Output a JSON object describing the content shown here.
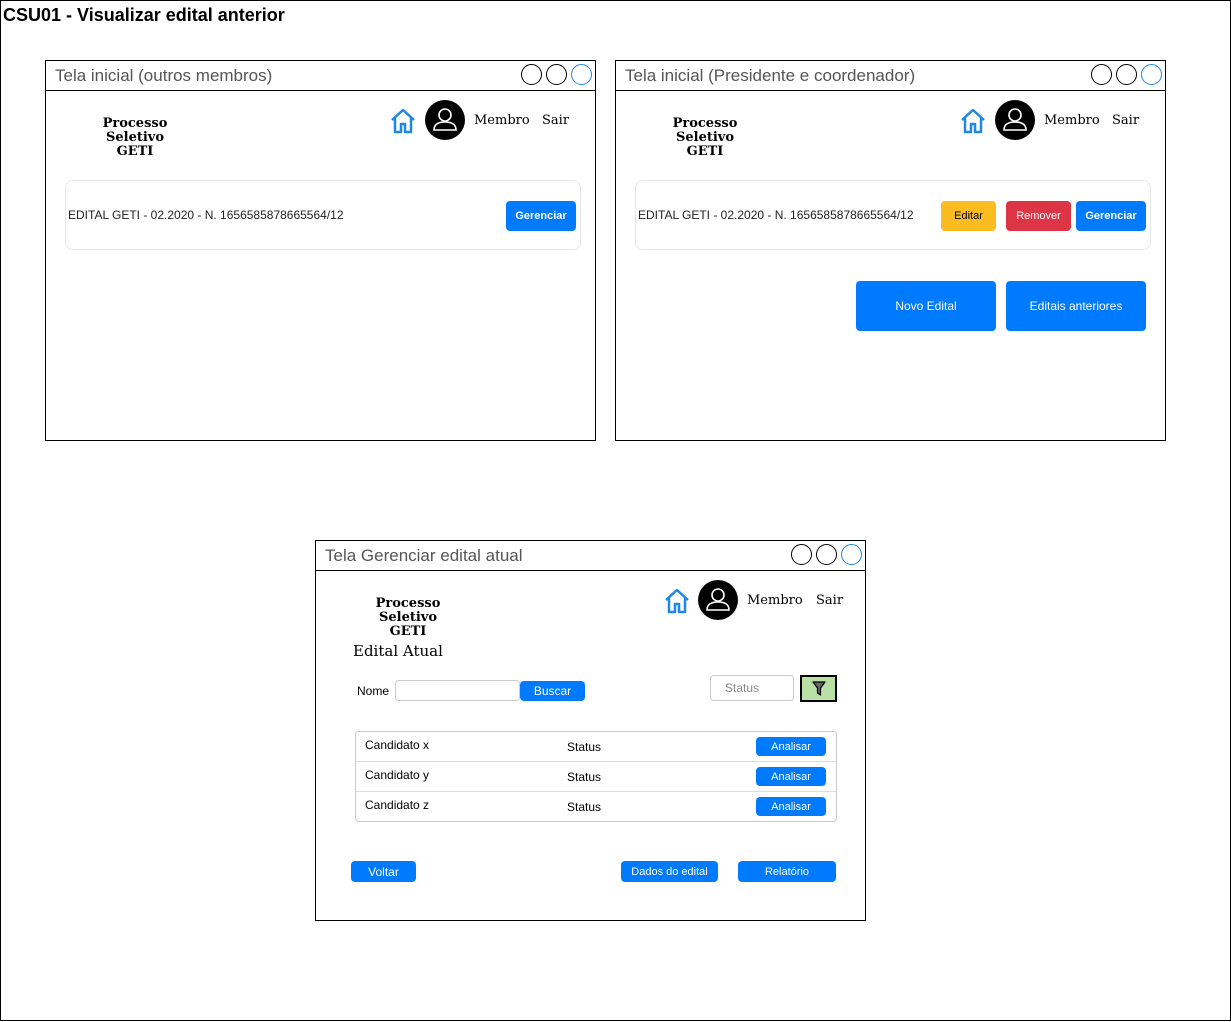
{
  "page_title": "CSU01 - Visualizar edital anterior",
  "brand": {
    "line1": "Processo Seletivo",
    "line2": "GETI"
  },
  "nav": {
    "membro": "Membro",
    "sair": "Sair"
  },
  "colors": {
    "primary": "#007bff",
    "warning": "#fbbc21",
    "danger": "#dc3545",
    "filter_bg": "#b9e0a5"
  },
  "window_members": {
    "title": "Tela inicial (outros membros)",
    "edital_text": "EDITAL GETI - 02.2020 - N. 1656585878665564/12",
    "gerenciar_label": "Gerenciar"
  },
  "window_president": {
    "title": "Tela inicial (Presidente e coordenador)",
    "edital_text": "EDITAL GETI - 02.2020 - N. 1656585878665564/12",
    "editar_label": "Editar",
    "remover_label": "Remover",
    "gerenciar_label": "Gerenciar",
    "novo_edital_label": "Novo Edital",
    "editais_anteriores_label": "Editais anteriores"
  },
  "window_manage": {
    "title": "Tela Gerenciar edital atual",
    "heading": "Edital Atual",
    "nome_label": "Nome",
    "buscar_label": "Buscar",
    "status_placeholder": "Status",
    "candidates": [
      {
        "name": "Candidato x",
        "status": "Status",
        "action": "Analisar"
      },
      {
        "name": "Candidato y",
        "status": "Status",
        "action": "Analisar"
      },
      {
        "name": "Candidato z",
        "status": "Status",
        "action": "Analisar"
      }
    ],
    "voltar_label": "Voltar",
    "dados_label": "Dados do edital",
    "relatorio_label": "Relatório"
  }
}
